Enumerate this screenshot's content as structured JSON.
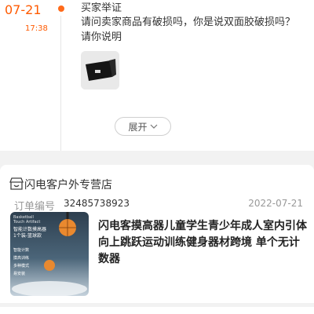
{
  "timeline": {
    "date": "07-21",
    "time": "17:38",
    "event_title": "买家举证",
    "event_body": "请问卖家商品有破损吗，你是说双面胶破损吗？请你说明",
    "expand_label": "展开"
  },
  "order": {
    "shop_name": "闪电客户外专营店",
    "order_label": "订单编号",
    "order_number": "32485738923",
    "order_date": "2022-07-21",
    "product_title": "闪电客摸高器儿童学生青少年成人室内引体向上跳跃运动训练健身器材跨境 单个无计数器",
    "product_image": {
      "brand": "Basketball Touch Artifact",
      "headline": "智能计数摸高器",
      "subline": "1个装-篮球款",
      "features": [
        "智能计数",
        "摸高训练",
        "多种模式",
        "易安装"
      ]
    }
  },
  "colors": {
    "accent": "#ff5a00",
    "background": "#f2f2f2",
    "card": "#ffffff"
  }
}
